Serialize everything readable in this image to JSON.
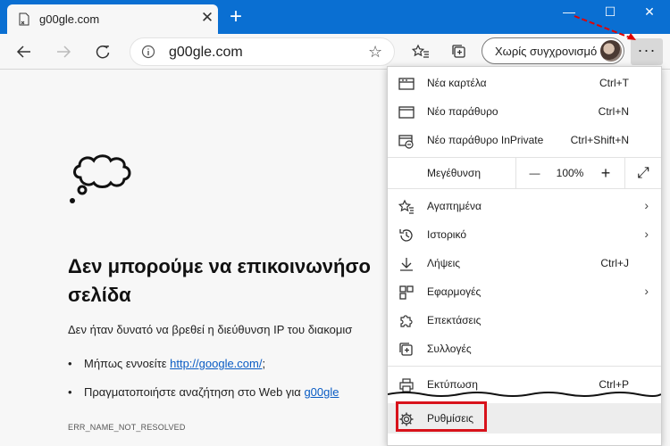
{
  "tab": {
    "title": "g00gle.com",
    "close": "✕",
    "new_tab": "+"
  },
  "window": {
    "minimize": "—",
    "maximize": "☐",
    "close": "✕"
  },
  "address": {
    "url": "g00gle.com",
    "star": "☆"
  },
  "sync": {
    "label": "Χωρίς συγχρονισμό"
  },
  "more_label": "···",
  "error": {
    "title_line1": "Δεν μπορούμε να επικοινωνήσο",
    "title_line2": "σελίδα",
    "description": "Δεν ήταν δυνατό να βρεθεί η διεύθυνση IP του διακομισ",
    "bullet_dot": "•",
    "bullet1_text": "Μήπως εννοείτε ",
    "bullet1_link": "http://google.com/",
    "bullet1_end": ";",
    "bullet2_text": "Πραγματοποιήστε αναζήτηση στο Web για ",
    "bullet2_link": "g00gle",
    "code": "ERR_NAME_NOT_RESOLVED"
  },
  "menu": {
    "new_tab": {
      "label": "Νέα καρτέλα",
      "shortcut": "Ctrl+T"
    },
    "new_window": {
      "label": "Νέο παράθυρο",
      "shortcut": "Ctrl+N"
    },
    "new_inprivate": {
      "label": "Νέο παράθυρο InPrivate",
      "shortcut": "Ctrl+Shift+N"
    },
    "zoom": {
      "label": "Μεγέθυνση",
      "minus": "—",
      "value": "100%",
      "plus": "+",
      "fullscreen": "⤢"
    },
    "favorites": {
      "label": "Αγαπημένα"
    },
    "history": {
      "label": "Ιστορικό"
    },
    "downloads": {
      "label": "Λήψεις",
      "shortcut": "Ctrl+J"
    },
    "apps": {
      "label": "Εφαρμογές"
    },
    "extensions": {
      "label": "Επεκτάσεις"
    },
    "collections": {
      "label": "Συλλογές"
    },
    "print": {
      "label": "Εκτύπωση",
      "shortcut": "Ctrl+P"
    },
    "settings": {
      "label": "Ρυθμίσεις"
    },
    "arrow": "›"
  },
  "colors": {
    "accent": "#0a6fd2",
    "highlight": "#d8121b",
    "annotation_arrow": "#e00000"
  }
}
